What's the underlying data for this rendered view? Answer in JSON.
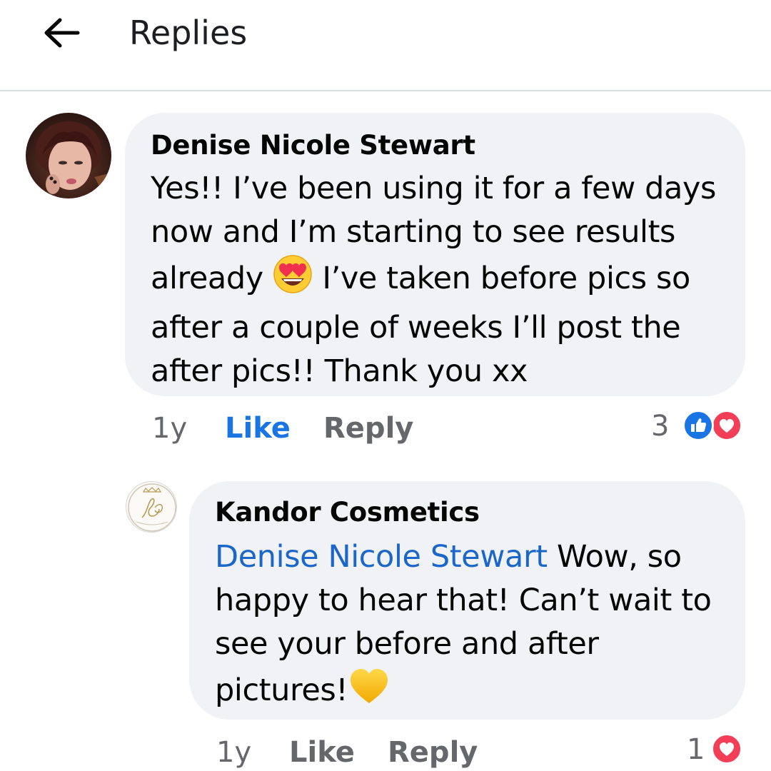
{
  "header": {
    "title": "Replies",
    "back_icon": "arrow-left-icon"
  },
  "comments": [
    {
      "author": "Denise Nicole Stewart",
      "text_lines": [
        "Yes!! I’ve been using it for a few days",
        "now and I’m starting to see results",
        "already",
        " I’ve taken before pics so",
        "after a couple of weeks I’ll post the",
        "after pics!! Thank you xx"
      ],
      "emoji": "heart-eyes-emoji",
      "time": "1y",
      "like_label": "Like",
      "reply_label": "Reply",
      "reaction_count": "3",
      "reactions": [
        "like-reaction-icon",
        "love-reaction-icon"
      ]
    },
    {
      "author": "Kandor Cosmetics",
      "mention": "Denise Nicole Stewart",
      "text_lines": [
        " Wow, so",
        "happy to hear that! Can’t wait to",
        "see your before and after",
        "pictures!"
      ],
      "emoji": "yellow-heart-emoji",
      "time": "1y",
      "like_label": "Like",
      "reply_label": "Reply",
      "reaction_count": "1",
      "reactions": [
        "love-reaction-icon"
      ]
    }
  ],
  "colors": {
    "like_blue": "#1b74e4",
    "mention_blue": "#1a66c9",
    "love_red": "#f33e58",
    "bubble_bg": "#f0f2f5",
    "meta_gray": "#65676b"
  }
}
